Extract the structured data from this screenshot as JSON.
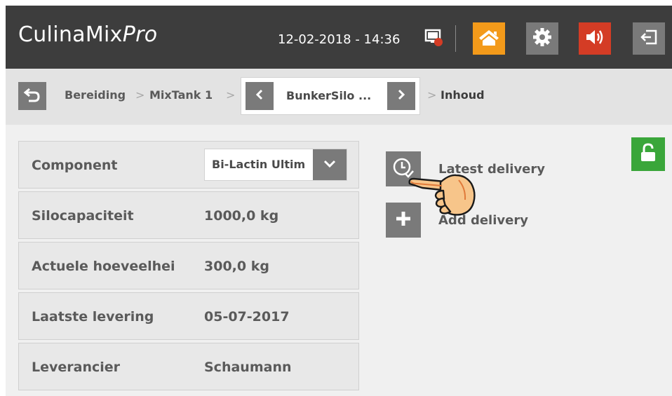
{
  "header": {
    "app_name": "CulinaMix",
    "app_name_suffix": "Pro",
    "datetime": "12-02-2018 - 14:36",
    "icons": [
      "monitor-alert-icon",
      "home-icon",
      "gear-icon",
      "speaker-icon",
      "logout-icon"
    ],
    "colors": {
      "bar": "#3d3d3d",
      "home": "#f39a1a",
      "speaker": "#d43c25",
      "neutral": "#7a7a7a"
    }
  },
  "breadcrumb": {
    "items": [
      "Bereiding",
      "MixTank 1"
    ],
    "current_selector": "BunkerSilo ...",
    "last": "Inhoud",
    "separator": ">"
  },
  "details": {
    "component": {
      "label": "Component",
      "value": "Bi-Lactin Ultim"
    },
    "rows": [
      {
        "label": "Silocapaciteit",
        "value": "1000,0 kg"
      },
      {
        "label": "Actuele hoeveelhei",
        "value": "300,0 kg"
      },
      {
        "label": "Laatste levering",
        "value": "05-07-2017"
      },
      {
        "label": "Leverancier",
        "value": "Schaumann"
      }
    ]
  },
  "actions": {
    "latest_delivery": "Latest delivery",
    "add_delivery": "Add delivery"
  },
  "colors": {
    "lock": "#3aa63a",
    "panel": "#e8e8e8",
    "text": "#5a5a5a"
  }
}
